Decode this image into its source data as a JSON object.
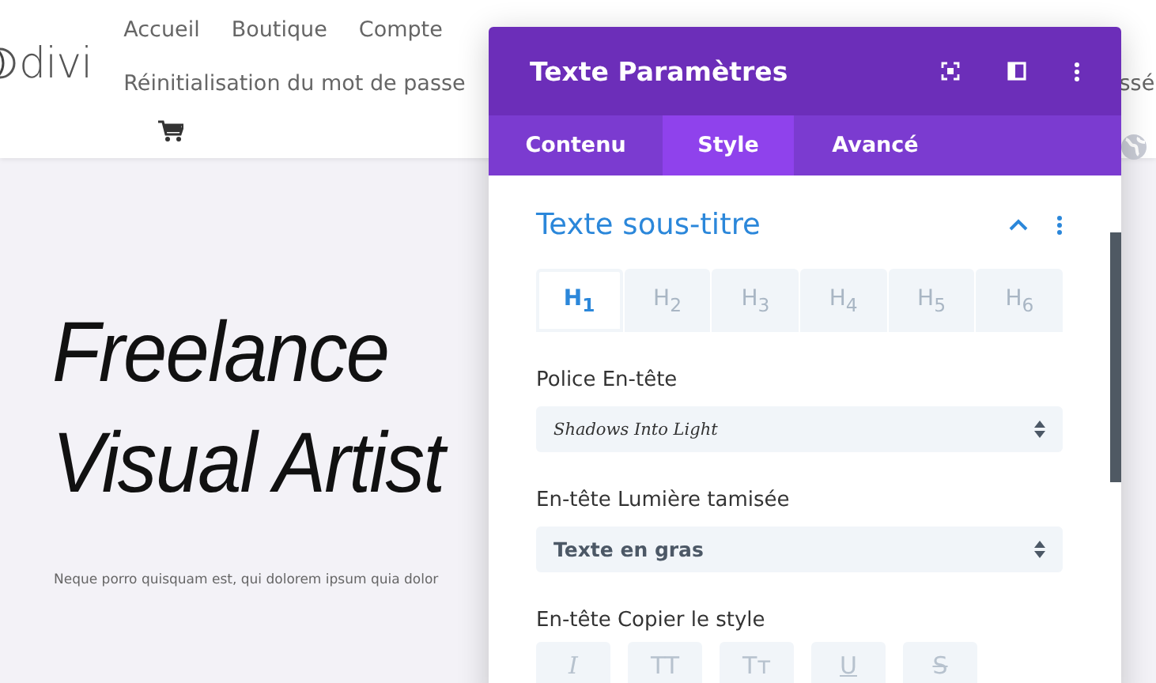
{
  "site": {
    "logo": "divi",
    "nav": [
      {
        "label": "Accueil"
      },
      {
        "label": "Boutique"
      },
      {
        "label": "Compte"
      }
    ],
    "nav_row2": [
      {
        "label": "Réinitialisation du mot de passe"
      },
      {
        "label": "ssé"
      }
    ],
    "hero": {
      "title_lines": [
        "Freelance",
        "Visual Artist"
      ],
      "paragraph": "Neque porro quisquam est, qui dolorem ipsum quia dolor"
    }
  },
  "panel": {
    "title": "Texte Paramètres",
    "tabs": [
      {
        "label": "Contenu",
        "selected": false
      },
      {
        "label": "Style",
        "selected": true
      },
      {
        "label": "Avancé",
        "selected": false
      }
    ],
    "section": {
      "title": "Texte sous-titre",
      "expanded": true
    },
    "heading_levels": [
      {
        "label": "H$_{1}$",
        "selected": true
      },
      {
        "label": "H$_{2}$",
        "selected": false
      },
      {
        "label": "H$_{3}$",
        "selected": false
      },
      {
        "label": "H$_{4}$",
        "selected": false
      },
      {
        "label": "H$_{5}$",
        "selected": false
      },
      {
        "label": "H$_{6}$",
        "selected": false
      }
    ],
    "fields": [
      {
        "label": "Police En-tête",
        "value": "Shadows Into Light",
        "kind": "font"
      },
      {
        "label": "En-tête Lumière tamisée",
        "value": "Texte en gras",
        "kind": "weight"
      }
    ],
    "copy_style": {
      "label": "En-tête Copier le style",
      "buttons": [
        {
          "label": "I",
          "kind": "italic"
        },
        {
          "label": "TT",
          "kind": "uppercase"
        },
        {
          "label": "Tᴛ",
          "kind": "smallcaps"
        },
        {
          "label": "U",
          "kind": "underline"
        },
        {
          "label": "S",
          "kind": "strikethrough"
        }
      ]
    }
  }
}
